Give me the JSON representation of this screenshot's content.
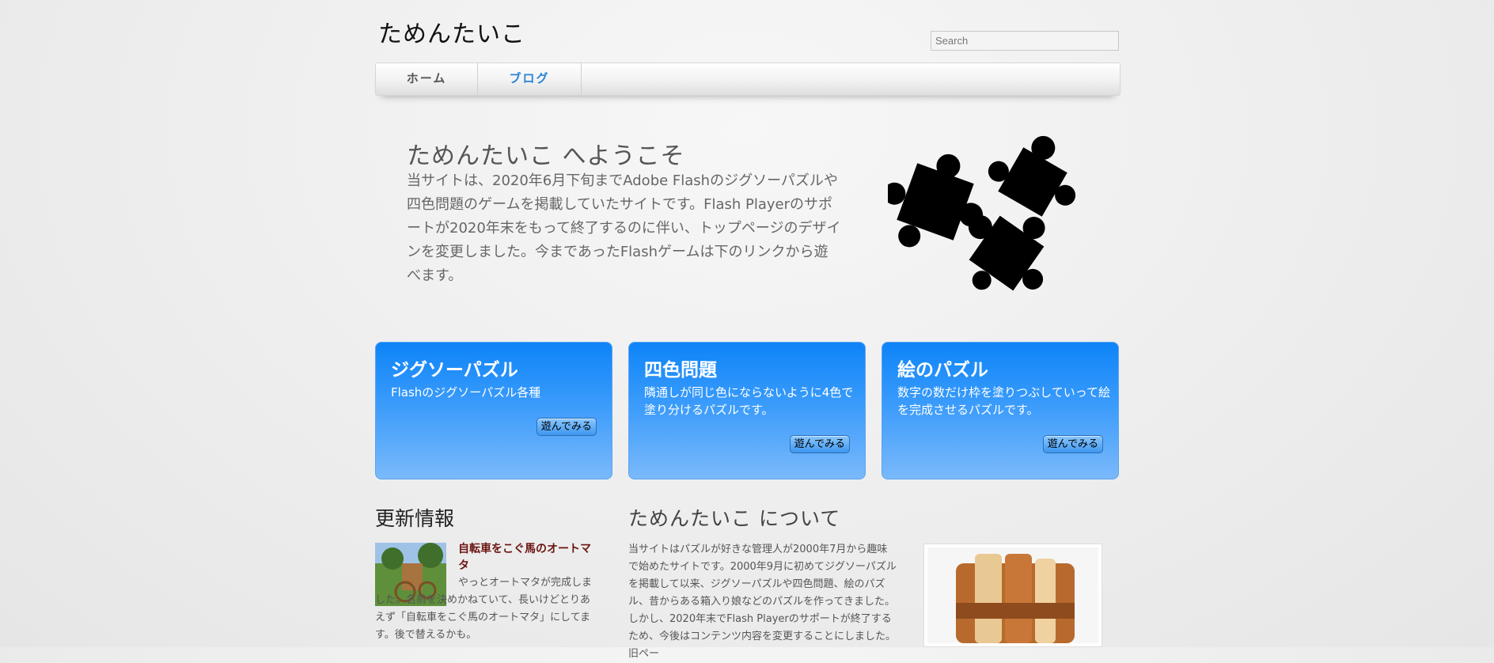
{
  "site": {
    "title": "ためんたいこ"
  },
  "search": {
    "placeholder": "Search"
  },
  "nav": {
    "items": [
      {
        "label": "ホーム"
      },
      {
        "label": "ブログ"
      }
    ]
  },
  "hero": {
    "title": "ためんたいこ へようこそ",
    "text": "当サイトは、2020年6月下旬までAdobe Flashのジグソーパズルや四色問題のゲームを掲載していたサイトです。Flash Playerのサポートが2020年末をもって終了するのに伴い、トップページのデザインを変更しました。今まであったFlashゲームは下のリンクから遊べます。",
    "image_icon": "puzzle-pieces-icon"
  },
  "cards": [
    {
      "title": "ジグソーパズル",
      "desc": "Flashのジグソーパズル各種",
      "button": "遊んでみる"
    },
    {
      "title": "四色問題",
      "desc": "隣通しが同じ色にならないように4色で塗り分けるパズルです。",
      "button": "遊んでみる"
    },
    {
      "title": "絵のパズル",
      "desc": "数字の数だけ枠を塗りつぶしていって絵を完成させるパズルです。",
      "button": "遊んでみる"
    }
  ],
  "news": {
    "title": "更新情報",
    "item": {
      "link": "自転車をこぐ馬のオートマタ",
      "text": "やっとオートマタが完成しました。名前を決めかねていて、長いけどとりあえず「自転車をこぐ馬のオートマタ」にしてます。後で替えるかも。"
    }
  },
  "about": {
    "title": "ためんたいこ について",
    "text": "当サイトはパズルが好きな管理人が2000年7月から趣味で始めたサイトです。2000年9月に初めてジグソーパズルを掲載して以来、ジグソーパズルや四色問題、絵のパズル、昔からある箱入り娘などのパズルを作ってきました。しかし、2020年末でFlash Playerのサポートが終了するため、今後はコンテンツ内容を変更することにしました。旧ペー"
  },
  "colors": {
    "accent": "#2a84d6",
    "card_top": "#0d84f8",
    "card_bottom": "#7ab9fb",
    "link": "#6b1410"
  }
}
